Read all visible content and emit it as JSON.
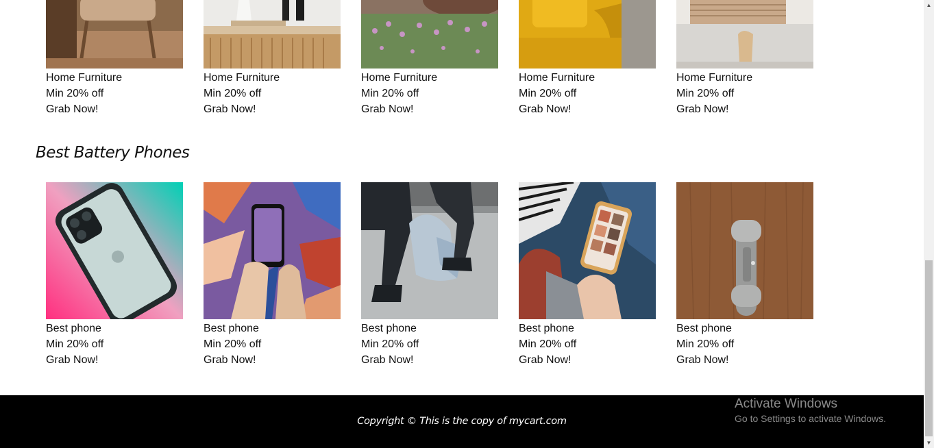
{
  "furniture": {
    "items": [
      {
        "title": "Home Furniture",
        "discount": "Min 20% off",
        "cta": "Grab Now!"
      },
      {
        "title": "Home Furniture",
        "discount": "Min 20% off",
        "cta": "Grab Now!"
      },
      {
        "title": "Home Furniture",
        "discount": "Min 20% off",
        "cta": "Grab Now!"
      },
      {
        "title": "Home Furniture",
        "discount": "Min 20% off",
        "cta": "Grab Now!"
      },
      {
        "title": "Home Furniture",
        "discount": "Min 20% off",
        "cta": "Grab Now!"
      }
    ]
  },
  "phones": {
    "section_title": "Best Battery Phones",
    "items": [
      {
        "title": "Best phone",
        "discount": "Min 20% off",
        "cta": "Grab Now!"
      },
      {
        "title": "Best phone",
        "discount": "Min 20% off",
        "cta": "Grab Now!"
      },
      {
        "title": "Best phone",
        "discount": "Min 20% off",
        "cta": "Grab Now!"
      },
      {
        "title": "Best phone",
        "discount": "Min 20% off",
        "cta": "Grab Now!"
      },
      {
        "title": "Best phone",
        "discount": "Min 20% off",
        "cta": "Grab Now!"
      }
    ]
  },
  "footer": {
    "copyright": "Copyright © This is the copy of mycart.com"
  },
  "watermark": {
    "title": "Activate Windows",
    "subtitle": "Go to Settings to activate Windows."
  }
}
